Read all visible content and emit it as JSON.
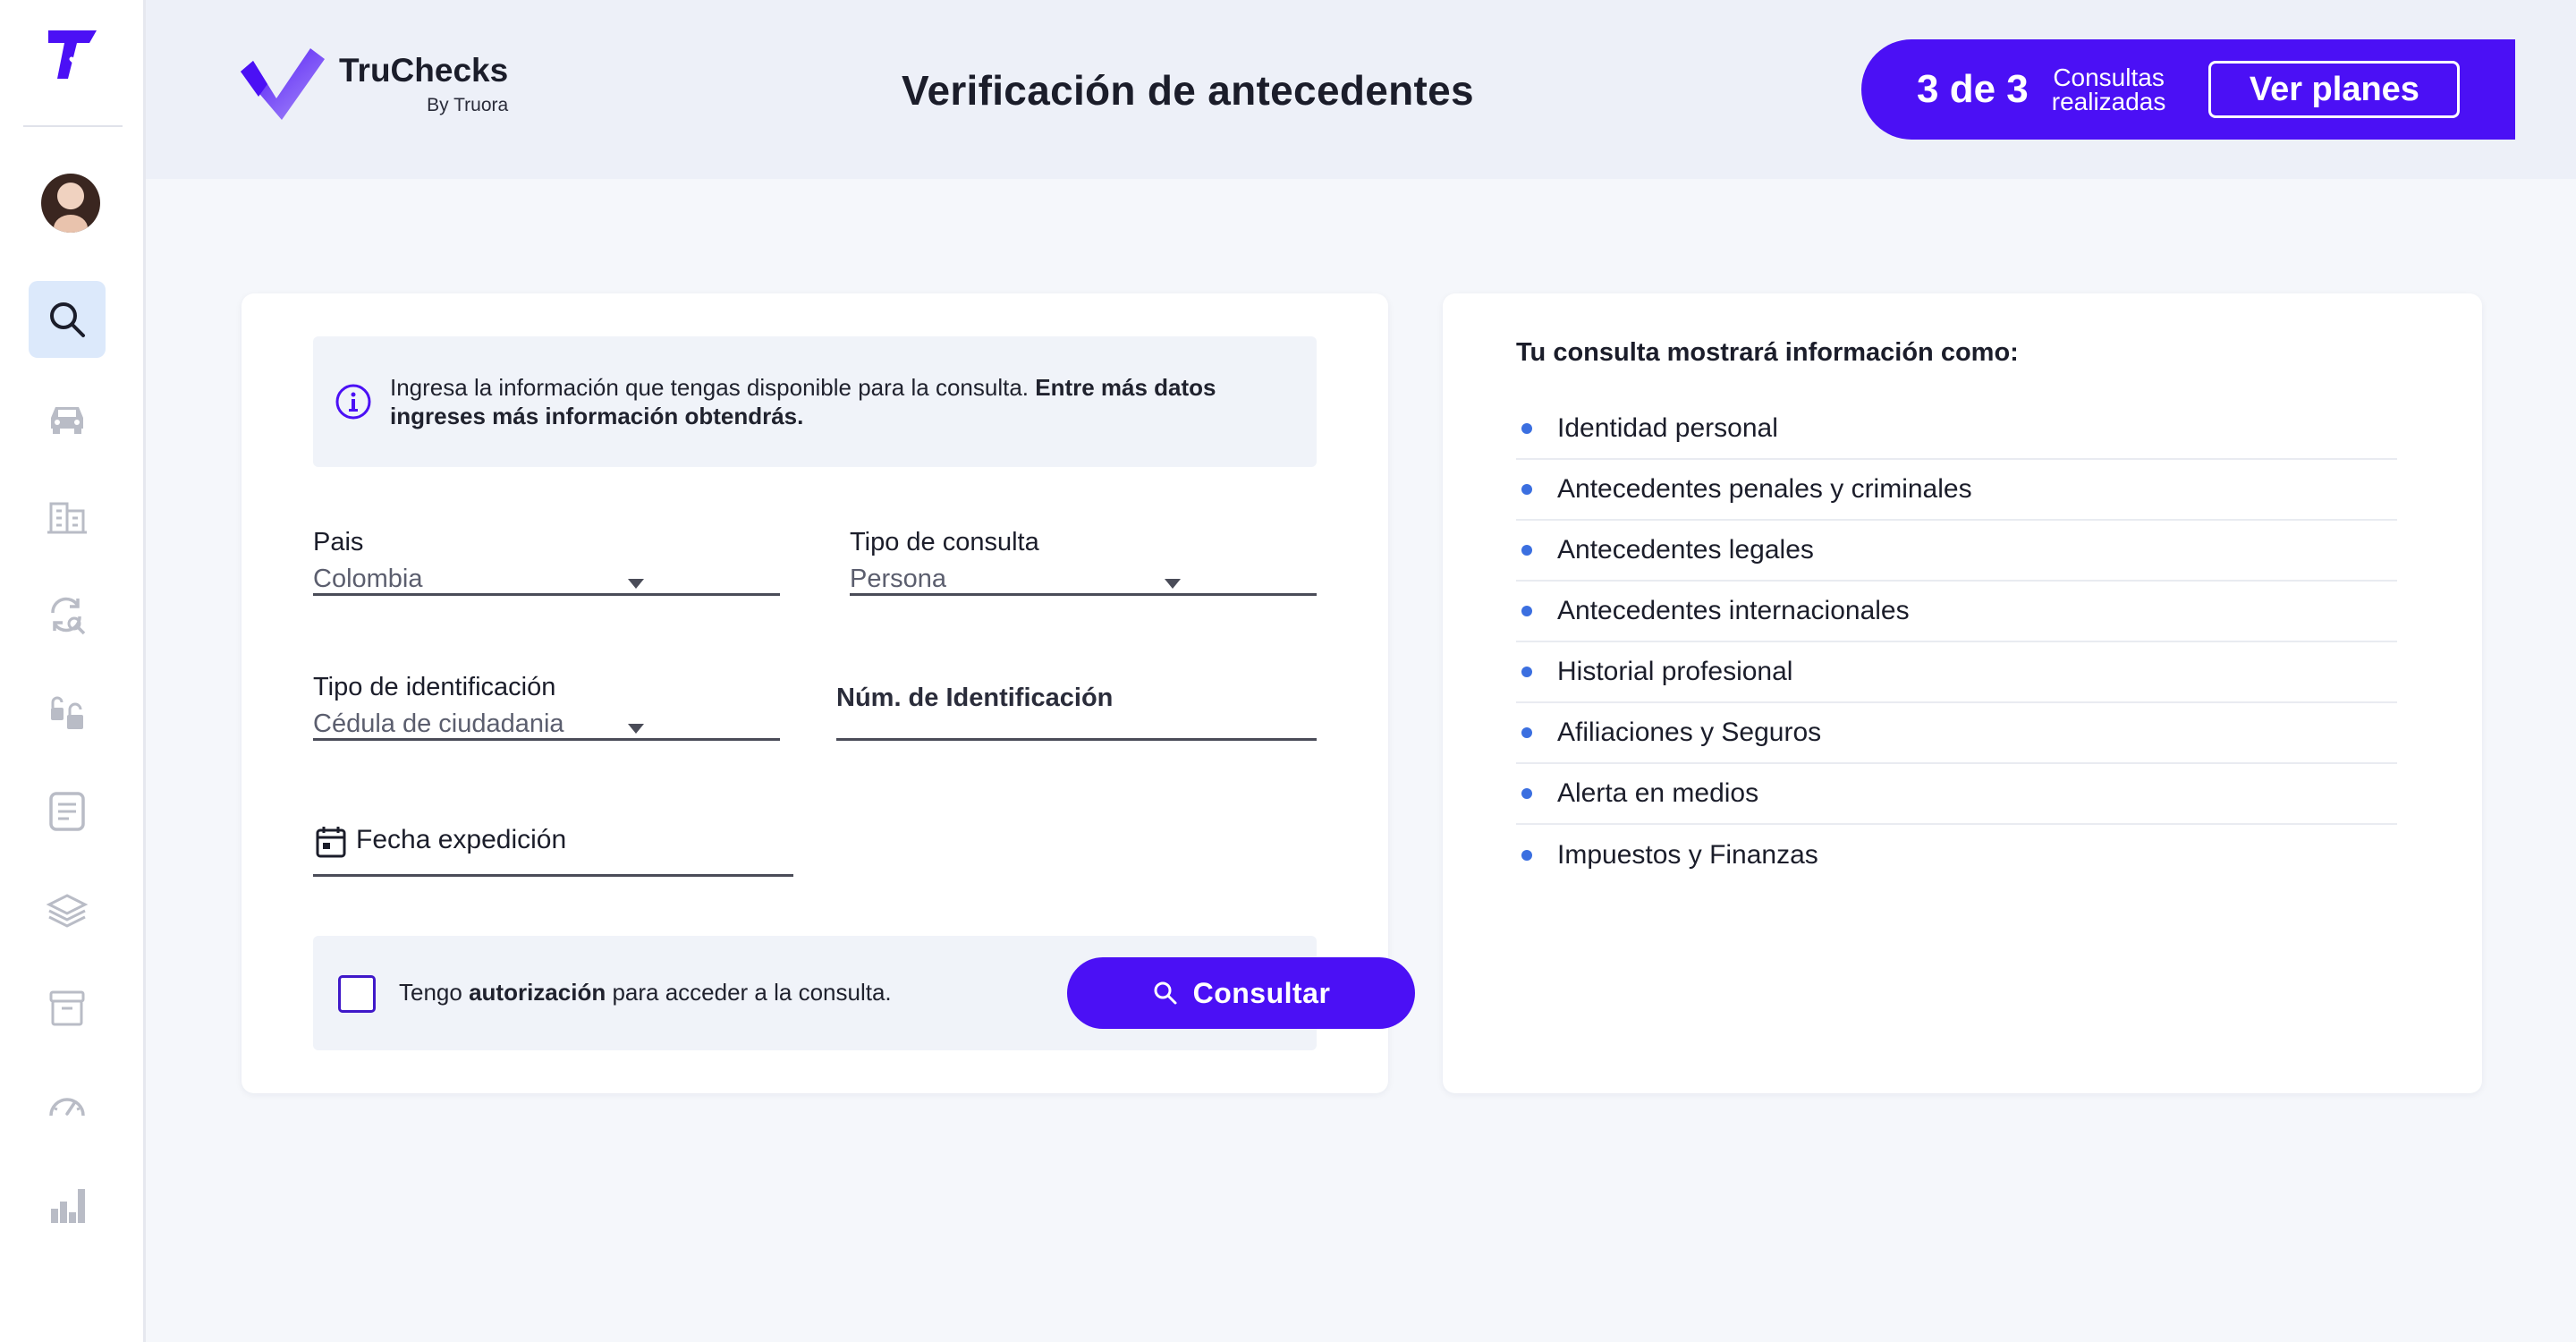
{
  "header": {
    "brand_name": "TruChecks",
    "brand_sub": "By Truora",
    "title": "Verificación de antecedentes",
    "plan": {
      "count": "3 de 3",
      "label_line1": "Consultas",
      "label_line2": "realizadas",
      "button": "Ver planes"
    }
  },
  "sidebar": {
    "items": [
      {
        "name": "search",
        "active": true
      },
      {
        "name": "car"
      },
      {
        "name": "buildings"
      },
      {
        "name": "refresh-search"
      },
      {
        "name": "unlock"
      },
      {
        "name": "document"
      },
      {
        "name": "layers"
      },
      {
        "name": "archive"
      },
      {
        "name": "speedometer"
      },
      {
        "name": "bar-chart"
      }
    ]
  },
  "form": {
    "info": "Ingresa la información que tengas disponible para la consulta. ",
    "info_bold": "Entre más datos ingreses más información obtendrás.",
    "pais_label": "Pais",
    "pais_value": "Colombia",
    "tipo_consulta_label": "Tipo de consulta",
    "tipo_consulta_value": "Persona",
    "tipo_id_label": "Tipo de identificación",
    "tipo_id_value": "Cédula de ciudadania",
    "num_id_label": "Núm. de Identificación",
    "fecha_label": "Fecha expedición",
    "auth_pre": "Tengo ",
    "auth_bold": "autorización",
    "auth_post": " para acceder a la consulta.",
    "consult_button": "Consultar"
  },
  "results": {
    "title": "Tu consulta mostrará información como:",
    "items": [
      "Identidad personal",
      "Antecedentes penales y criminales",
      "Antecedentes legales",
      "Antecedentes internacionales",
      "Historial profesional",
      "Afiliaciones y Seguros",
      "Alerta en medios",
      "Impuestos y Finanzas"
    ]
  },
  "colors": {
    "accent": "#4b10f5",
    "bullet": "#3b6fe0",
    "sidebar_active": "#dce9fb"
  }
}
